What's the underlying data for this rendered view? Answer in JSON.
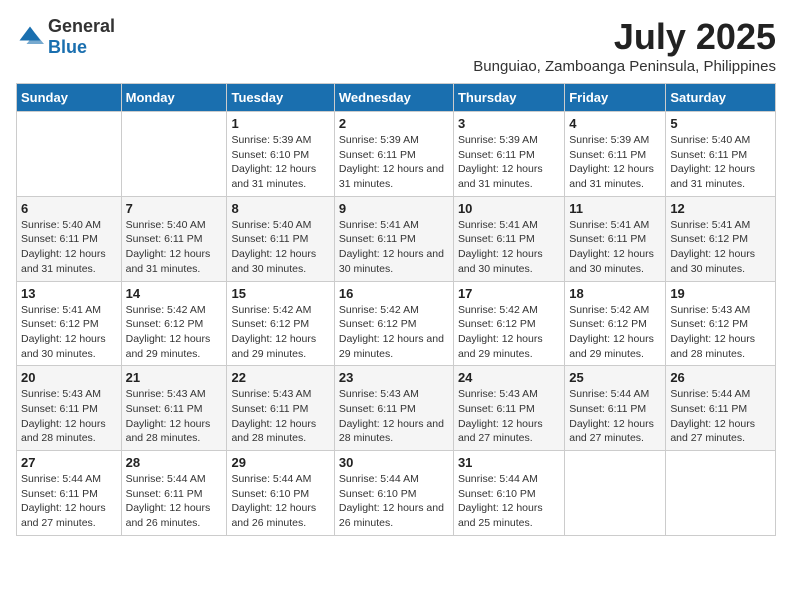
{
  "logo": {
    "text_general": "General",
    "text_blue": "Blue"
  },
  "header": {
    "month": "July 2025",
    "location": "Bunguiao, Zamboanga Peninsula, Philippines"
  },
  "weekdays": [
    "Sunday",
    "Monday",
    "Tuesday",
    "Wednesday",
    "Thursday",
    "Friday",
    "Saturday"
  ],
  "weeks": [
    [
      {
        "day": "",
        "info": ""
      },
      {
        "day": "",
        "info": ""
      },
      {
        "day": "1",
        "info": "Sunrise: 5:39 AM\nSunset: 6:10 PM\nDaylight: 12 hours and 31 minutes."
      },
      {
        "day": "2",
        "info": "Sunrise: 5:39 AM\nSunset: 6:11 PM\nDaylight: 12 hours and 31 minutes."
      },
      {
        "day": "3",
        "info": "Sunrise: 5:39 AM\nSunset: 6:11 PM\nDaylight: 12 hours and 31 minutes."
      },
      {
        "day": "4",
        "info": "Sunrise: 5:39 AM\nSunset: 6:11 PM\nDaylight: 12 hours and 31 minutes."
      },
      {
        "day": "5",
        "info": "Sunrise: 5:40 AM\nSunset: 6:11 PM\nDaylight: 12 hours and 31 minutes."
      }
    ],
    [
      {
        "day": "6",
        "info": "Sunrise: 5:40 AM\nSunset: 6:11 PM\nDaylight: 12 hours and 31 minutes."
      },
      {
        "day": "7",
        "info": "Sunrise: 5:40 AM\nSunset: 6:11 PM\nDaylight: 12 hours and 31 minutes."
      },
      {
        "day": "8",
        "info": "Sunrise: 5:40 AM\nSunset: 6:11 PM\nDaylight: 12 hours and 30 minutes."
      },
      {
        "day": "9",
        "info": "Sunrise: 5:41 AM\nSunset: 6:11 PM\nDaylight: 12 hours and 30 minutes."
      },
      {
        "day": "10",
        "info": "Sunrise: 5:41 AM\nSunset: 6:11 PM\nDaylight: 12 hours and 30 minutes."
      },
      {
        "day": "11",
        "info": "Sunrise: 5:41 AM\nSunset: 6:11 PM\nDaylight: 12 hours and 30 minutes."
      },
      {
        "day": "12",
        "info": "Sunrise: 5:41 AM\nSunset: 6:12 PM\nDaylight: 12 hours and 30 minutes."
      }
    ],
    [
      {
        "day": "13",
        "info": "Sunrise: 5:41 AM\nSunset: 6:12 PM\nDaylight: 12 hours and 30 minutes."
      },
      {
        "day": "14",
        "info": "Sunrise: 5:42 AM\nSunset: 6:12 PM\nDaylight: 12 hours and 29 minutes."
      },
      {
        "day": "15",
        "info": "Sunrise: 5:42 AM\nSunset: 6:12 PM\nDaylight: 12 hours and 29 minutes."
      },
      {
        "day": "16",
        "info": "Sunrise: 5:42 AM\nSunset: 6:12 PM\nDaylight: 12 hours and 29 minutes."
      },
      {
        "day": "17",
        "info": "Sunrise: 5:42 AM\nSunset: 6:12 PM\nDaylight: 12 hours and 29 minutes."
      },
      {
        "day": "18",
        "info": "Sunrise: 5:42 AM\nSunset: 6:12 PM\nDaylight: 12 hours and 29 minutes."
      },
      {
        "day": "19",
        "info": "Sunrise: 5:43 AM\nSunset: 6:12 PM\nDaylight: 12 hours and 28 minutes."
      }
    ],
    [
      {
        "day": "20",
        "info": "Sunrise: 5:43 AM\nSunset: 6:11 PM\nDaylight: 12 hours and 28 minutes."
      },
      {
        "day": "21",
        "info": "Sunrise: 5:43 AM\nSunset: 6:11 PM\nDaylight: 12 hours and 28 minutes."
      },
      {
        "day": "22",
        "info": "Sunrise: 5:43 AM\nSunset: 6:11 PM\nDaylight: 12 hours and 28 minutes."
      },
      {
        "day": "23",
        "info": "Sunrise: 5:43 AM\nSunset: 6:11 PM\nDaylight: 12 hours and 28 minutes."
      },
      {
        "day": "24",
        "info": "Sunrise: 5:43 AM\nSunset: 6:11 PM\nDaylight: 12 hours and 27 minutes."
      },
      {
        "day": "25",
        "info": "Sunrise: 5:44 AM\nSunset: 6:11 PM\nDaylight: 12 hours and 27 minutes."
      },
      {
        "day": "26",
        "info": "Sunrise: 5:44 AM\nSunset: 6:11 PM\nDaylight: 12 hours and 27 minutes."
      }
    ],
    [
      {
        "day": "27",
        "info": "Sunrise: 5:44 AM\nSunset: 6:11 PM\nDaylight: 12 hours and 27 minutes."
      },
      {
        "day": "28",
        "info": "Sunrise: 5:44 AM\nSunset: 6:11 PM\nDaylight: 12 hours and 26 minutes."
      },
      {
        "day": "29",
        "info": "Sunrise: 5:44 AM\nSunset: 6:10 PM\nDaylight: 12 hours and 26 minutes."
      },
      {
        "day": "30",
        "info": "Sunrise: 5:44 AM\nSunset: 6:10 PM\nDaylight: 12 hours and 26 minutes."
      },
      {
        "day": "31",
        "info": "Sunrise: 5:44 AM\nSunset: 6:10 PM\nDaylight: 12 hours and 25 minutes."
      },
      {
        "day": "",
        "info": ""
      },
      {
        "day": "",
        "info": ""
      }
    ]
  ]
}
